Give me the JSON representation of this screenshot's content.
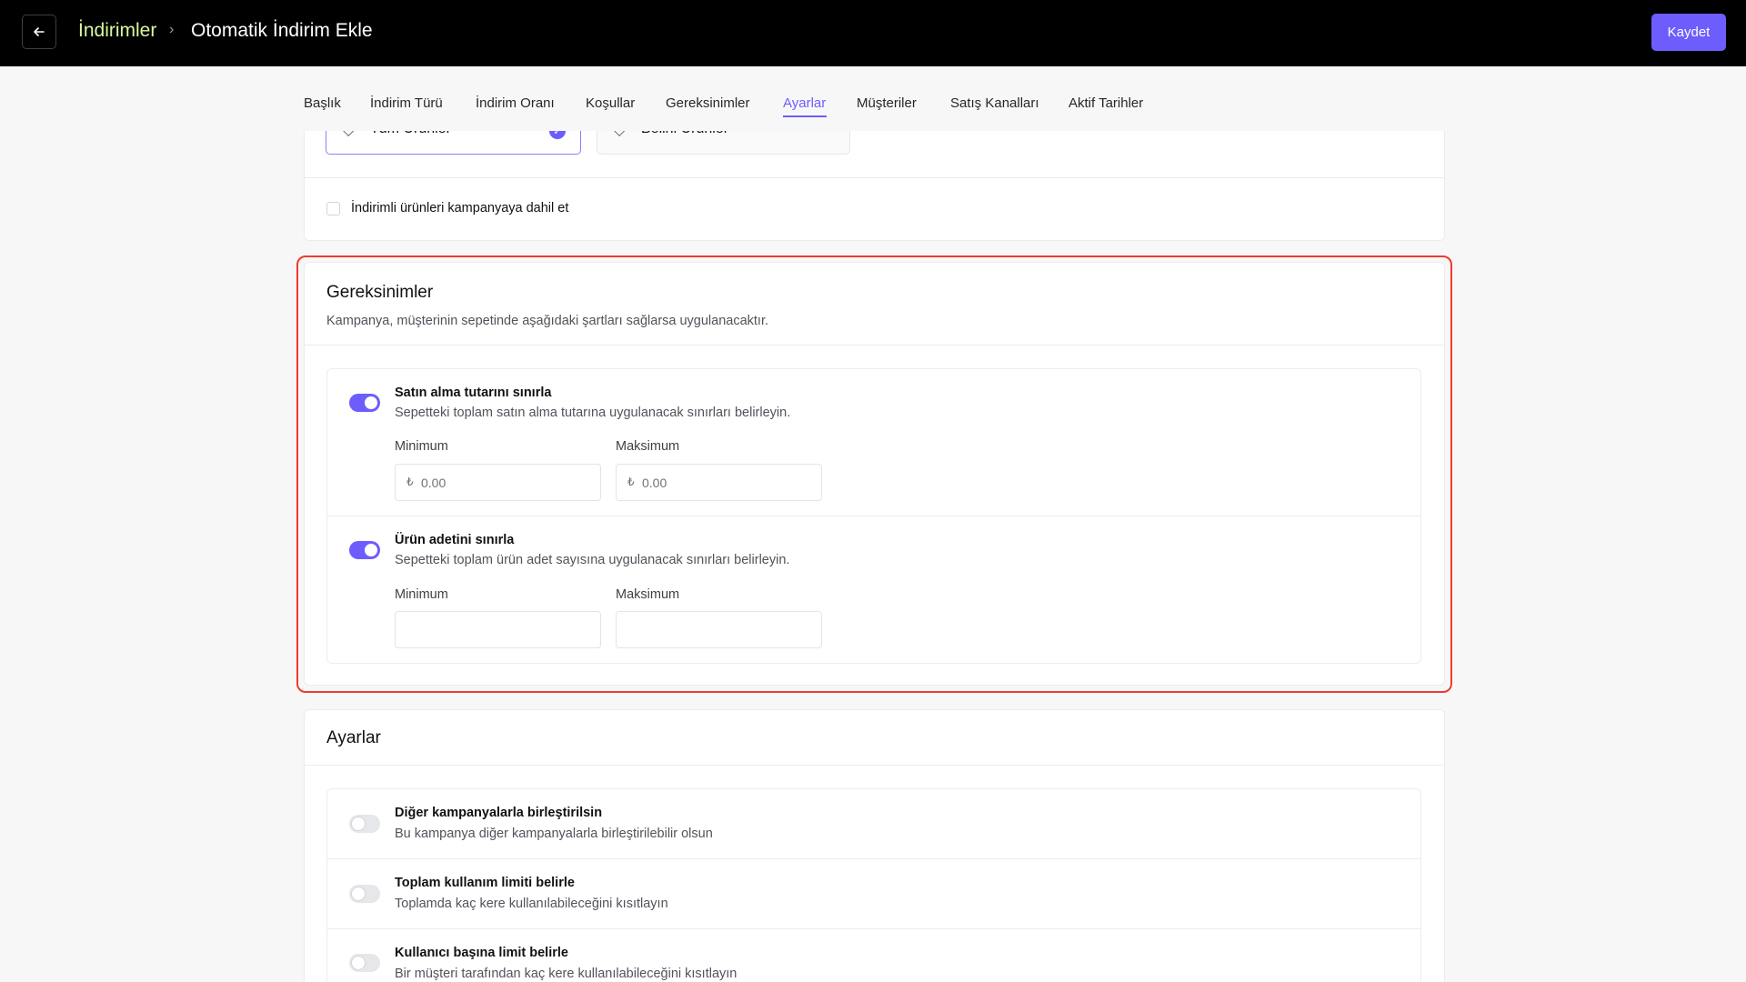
{
  "header": {
    "breadcrumb_parent": "İndirimler",
    "breadcrumb_current": "Otomatik İndirim Ekle",
    "save_label": "Kaydet"
  },
  "tabs": [
    {
      "label": "Başlık"
    },
    {
      "label": "İndirim Türü"
    },
    {
      "label": "İndirim Oranı"
    },
    {
      "label": "Koşullar"
    },
    {
      "label": "Gereksinimler"
    },
    {
      "label": "Ayarlar",
      "active": true
    },
    {
      "label": "Müşteriler"
    },
    {
      "label": "Satış Kanalları"
    },
    {
      "label": "Aktif Tarihler"
    }
  ],
  "products": {
    "all_label": "Tüm Ürünler",
    "specific_label": "Belirli Ürünler",
    "include_discounted_label": "İndirimli ürünleri kampanyaya dahil et"
  },
  "requirements": {
    "title": "Gereksinimler",
    "subtitle": "Kampanya, müşterinin sepetinde aşağıdaki şartları sağlarsa uygulanacaktır.",
    "purchase_amount": {
      "title": "Satın alma tutarını sınırla",
      "desc": "Sepetteki toplam satın alma tutarına uygulanacak sınırları belirleyin.",
      "enabled": true,
      "min_label": "Minimum",
      "max_label": "Maksimum",
      "currency_symbol": "₺",
      "min_placeholder": "0.00",
      "max_placeholder": "0.00"
    },
    "item_count": {
      "title": "Ürün adetini sınırla",
      "desc": "Sepetteki toplam ürün adet sayısına uygulanacak sınırları belirleyin.",
      "enabled": true,
      "min_label": "Minimum",
      "max_label": "Maksimum"
    }
  },
  "settings": {
    "title": "Ayarlar",
    "items": [
      {
        "title": "Diğer kampanyalarla birleştirilsin",
        "desc": "Bu kampanya diğer kampanyalarla birleştirilebilir olsun",
        "enabled": false
      },
      {
        "title": "Toplam kullanım limiti belirle",
        "desc": "Toplamda kaç kere kullanılabileceğini kısıtlayın",
        "enabled": false
      },
      {
        "title": "Kullanıcı başına limit belirle",
        "desc": "Bir müşteri tarafından kaç kere kullanılabileceğini kısıtlayın",
        "enabled": false
      }
    ]
  },
  "colors": {
    "accent": "#6d5dfc",
    "breadcrumb_parent": "#d9f99d",
    "highlight_border": "#ef3b2d",
    "topbar_bg": "#000000"
  },
  "icons": [
    "arrow-left-icon",
    "chevron-right-icon",
    "tag-icon",
    "check-icon"
  ]
}
